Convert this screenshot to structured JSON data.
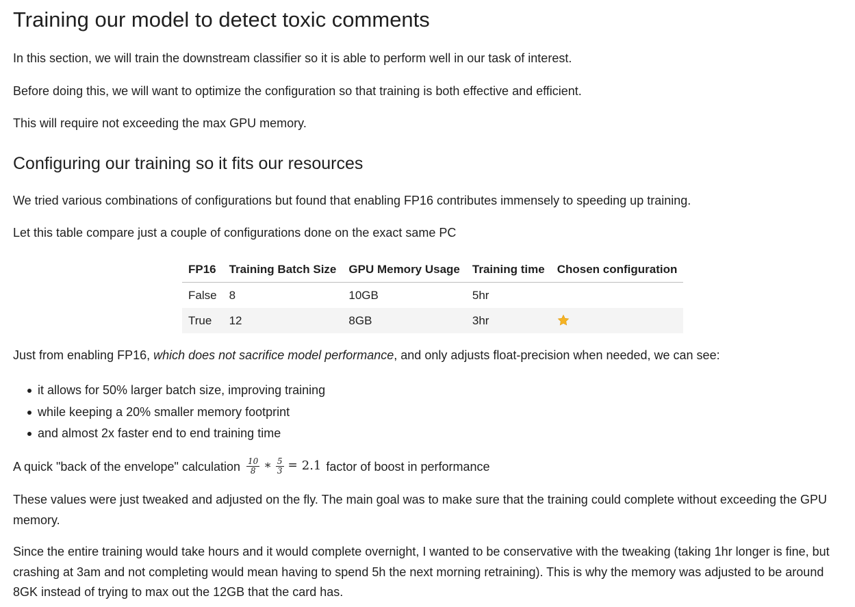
{
  "heading1": "Training our model to detect toxic comments",
  "intro": [
    "In this section, we will train the downstream classifier so it is able to perform well in our task of interest.",
    "Before doing this, we will want to optimize the configuration so that training is both effective and efficient.",
    "This will require not exceeding the max GPU memory."
  ],
  "heading2": "Configuring our training so it fits our resources",
  "section2": [
    "We tried various combinations of configurations but found that enabling FP16 contributes immensely to speeding up training.",
    "Let this table compare just a couple of configurations done on the exact same PC"
  ],
  "table": {
    "headers": [
      "FP16",
      "Training Batch Size",
      "GPU Memory Usage",
      "Training time",
      "Chosen configuration"
    ],
    "rows": [
      [
        "False",
        "8",
        "10GB",
        "5hr",
        ""
      ],
      [
        "True",
        "12",
        "8GB",
        "3hr",
        ""
      ]
    ],
    "chosen_icon": "star-icon",
    "star_color": "#f5b324"
  },
  "observation": {
    "prefix": "Just from enabling FP16, ",
    "emphasis": "which does not sacrifice model performance",
    "suffix": ", and only adjusts float-precision when needed, we can see:"
  },
  "bullets": [
    "it allows for 50% larger batch size, improving training",
    "while keeping a 20% smaller memory footprint",
    "and almost 2x faster end to end training time"
  ],
  "calc": {
    "prefix": "A quick \"back of the envelope\" calculation",
    "frac1_num": "10",
    "frac1_den": "8",
    "op_mul": "∗",
    "frac2_num": "5",
    "frac2_den": "3",
    "op_eq": "=",
    "result": "2.1",
    "suffix": "factor of boost in performance"
  },
  "closing": [
    "These values were just tweaked and adjusted on the fly. The main goal was to make sure that the training could complete without exceeding the GPU memory.",
    "Since the entire training would take hours and it would complete overnight, I wanted to be conservative with the tweaking (taking 1hr longer is fine, but crashing at 3am and not completing would mean having to spend 5h the next morning retraining). This is why the memory was adjusted to be around 8GK instead of trying to max out the 12GB that the card has."
  ]
}
